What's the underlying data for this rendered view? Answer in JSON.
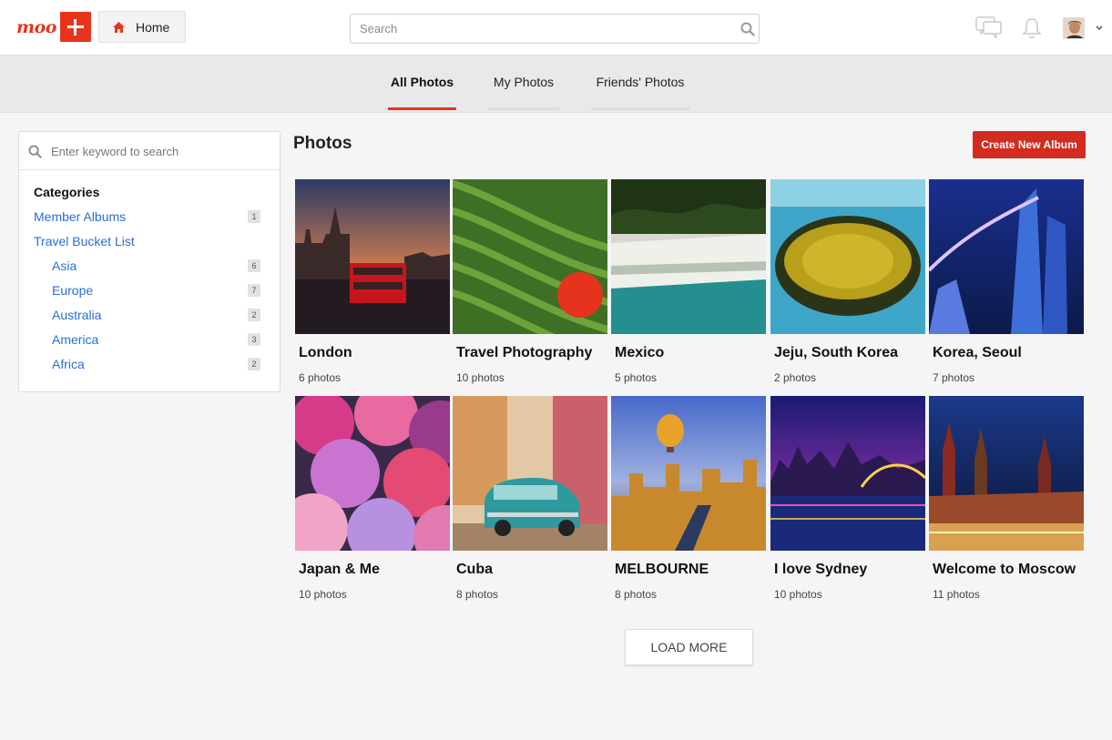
{
  "header": {
    "logo_text": "moo",
    "home_label": "Home",
    "search_placeholder": "Search",
    "accent_color": "#e8341c"
  },
  "tabs": [
    {
      "label": "All Photos",
      "active": true
    },
    {
      "label": "My Photos",
      "active": false
    },
    {
      "label": "Friends' Photos",
      "active": false
    }
  ],
  "sidebar": {
    "search_placeholder": "Enter keyword to search",
    "categories_title": "Categories",
    "items": [
      {
        "label": "Member Albums",
        "count": "1"
      },
      {
        "label": "Travel Bucket List",
        "count": ""
      },
      {
        "label": "Asia",
        "count": "6"
      },
      {
        "label": "Europe",
        "count": "7"
      },
      {
        "label": "Australia",
        "count": "2"
      },
      {
        "label": "America",
        "count": "3"
      },
      {
        "label": "Africa",
        "count": "2"
      }
    ]
  },
  "main": {
    "title": "Photos",
    "create_label": "Create New Album",
    "load_more_label": "LOAD MORE",
    "albums": [
      {
        "title": "London",
        "count": "6 photos"
      },
      {
        "title": "Travel Photography",
        "count": "10 photos"
      },
      {
        "title": "Mexico",
        "count": "5 photos"
      },
      {
        "title": "Jeju, South Korea",
        "count": "2 photos"
      },
      {
        "title": "Korea, Seoul",
        "count": "7 photos"
      },
      {
        "title": "Japan & Me",
        "count": "10 photos"
      },
      {
        "title": "Cuba",
        "count": "8 photos"
      },
      {
        "title": "MELBOURNE",
        "count": "8 photos"
      },
      {
        "title": "I love Sydney",
        "count": "10 photos"
      },
      {
        "title": "Welcome to Moscow",
        "count": "11 photos"
      }
    ]
  }
}
